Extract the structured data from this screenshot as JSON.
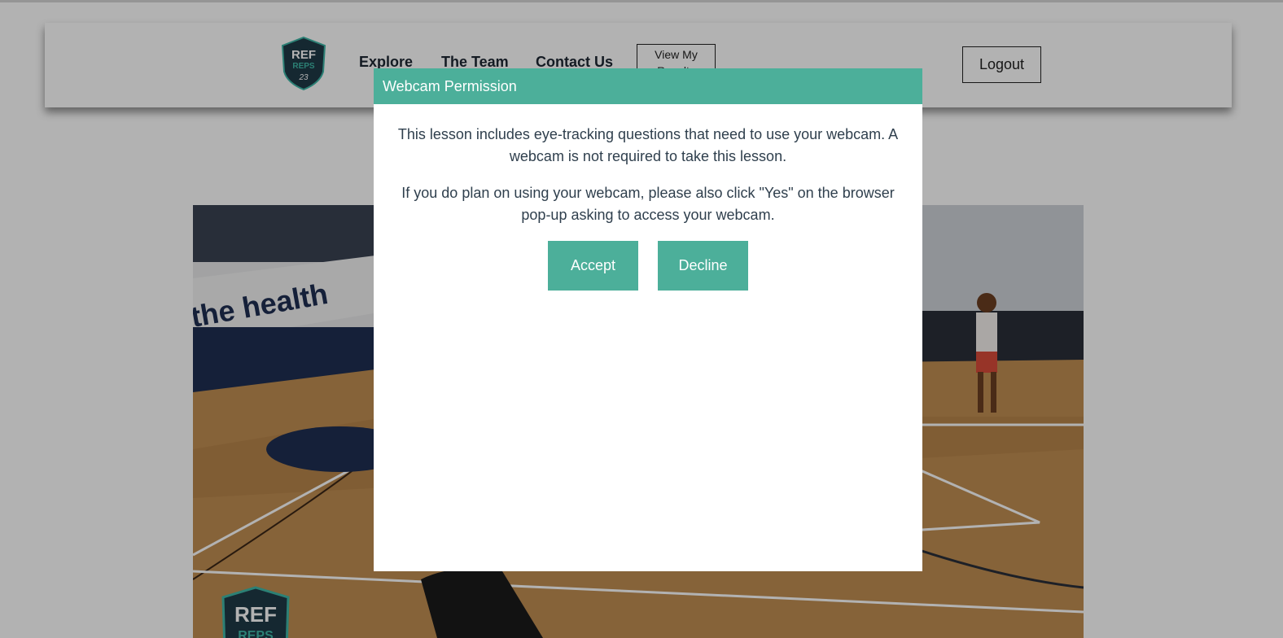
{
  "header": {
    "logo_text_top": "REF",
    "logo_text_bottom": "REPS",
    "logo_mark": "23",
    "nav": [
      {
        "label": "Explore"
      },
      {
        "label": "The Team"
      },
      {
        "label": "Contact Us"
      }
    ],
    "results_button_label": "View My Results",
    "logout_label": "Logout"
  },
  "video": {
    "watermark_text_top": "REF",
    "watermark_text_bottom": "REPS",
    "banner_text": "the health"
  },
  "modal": {
    "title": "Webcam Permission",
    "paragraph_1": "This lesson includes eye-tracking questions that need to use your webcam. A webcam is not required to take this lesson.",
    "paragraph_2": "If you do plan on using your webcam, please also click \"Yes\" on the browser pop-up asking to access your webcam.",
    "accept_label": "Accept",
    "decline_label": "Decline"
  },
  "colors": {
    "accent": "#4caf9a",
    "overlay": "rgba(0,0,0,0.30)",
    "logo_dark": "#1f3a47",
    "logo_teal": "#3fb8a8"
  }
}
